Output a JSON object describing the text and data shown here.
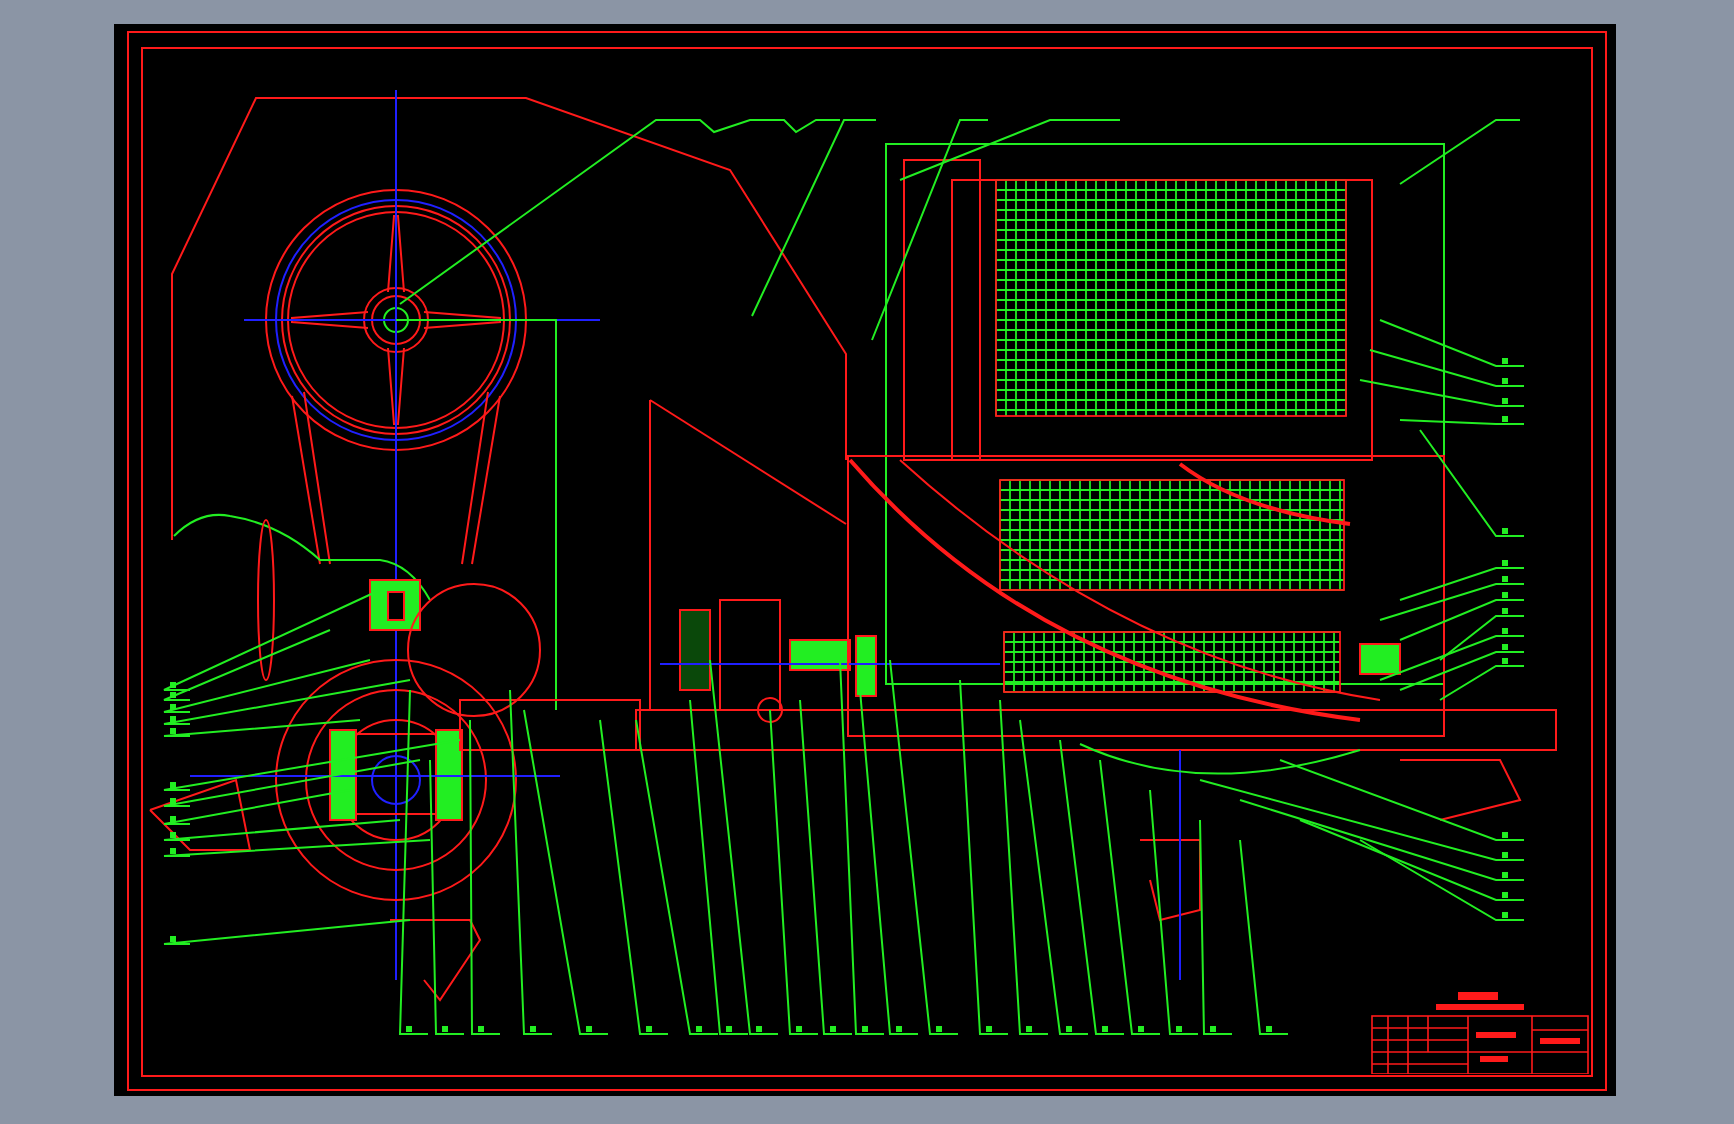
{
  "sheet": {
    "kind": "cad-drawing"
  }
}
